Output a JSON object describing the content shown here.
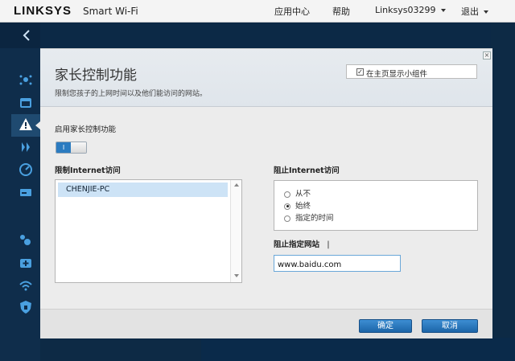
{
  "brand": {
    "logo": "LINKSYS",
    "product": "Smart Wi-Fi"
  },
  "topnav": {
    "app_center": "应用中心",
    "help": "帮助",
    "router": "Linksys03299",
    "logout": "退出"
  },
  "panel": {
    "title": "家长控制功能",
    "subtitle": "限制您孩子的上网时间以及他们能访问的网站。",
    "show_widget_label": "在主页显示小组件",
    "show_widget_checked": true,
    "enable_label": "启用家长控制功能",
    "enable_state": "I",
    "restrict_devices_label": "限制Internet访问",
    "devices": [
      "CHENJIE-PC"
    ],
    "block_internet_label": "阻止Internet访问",
    "block_options": [
      "从不",
      "始终",
      "指定的时间"
    ],
    "block_selected": "始终",
    "block_sites_label": "阻止指定网站",
    "block_sites_cursor": "|",
    "site_value": "www.baidu.com",
    "ok_label": "确定",
    "cancel_label": "取消"
  },
  "colors": {
    "accent": "#2b7bc0",
    "dark_bg": "#0f2d4b",
    "selection": "#cde3f6"
  }
}
